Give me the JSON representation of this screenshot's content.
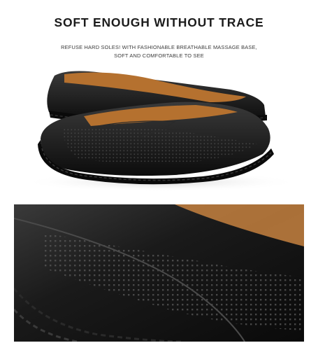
{
  "heading": {
    "title": "SOFT ENOUGH WITHOUT TRACE",
    "line1": "REFUSE HARD SOLES! WITH FASHIONABLE BREATHABLE MASSAGE BASE,",
    "line2": "SOFT AND COMFORTABLE TO SEE"
  },
  "colors": {
    "background": "#ffffff",
    "leather": "#141414",
    "lining": "#b5712f",
    "text": "#1c1c1c"
  }
}
